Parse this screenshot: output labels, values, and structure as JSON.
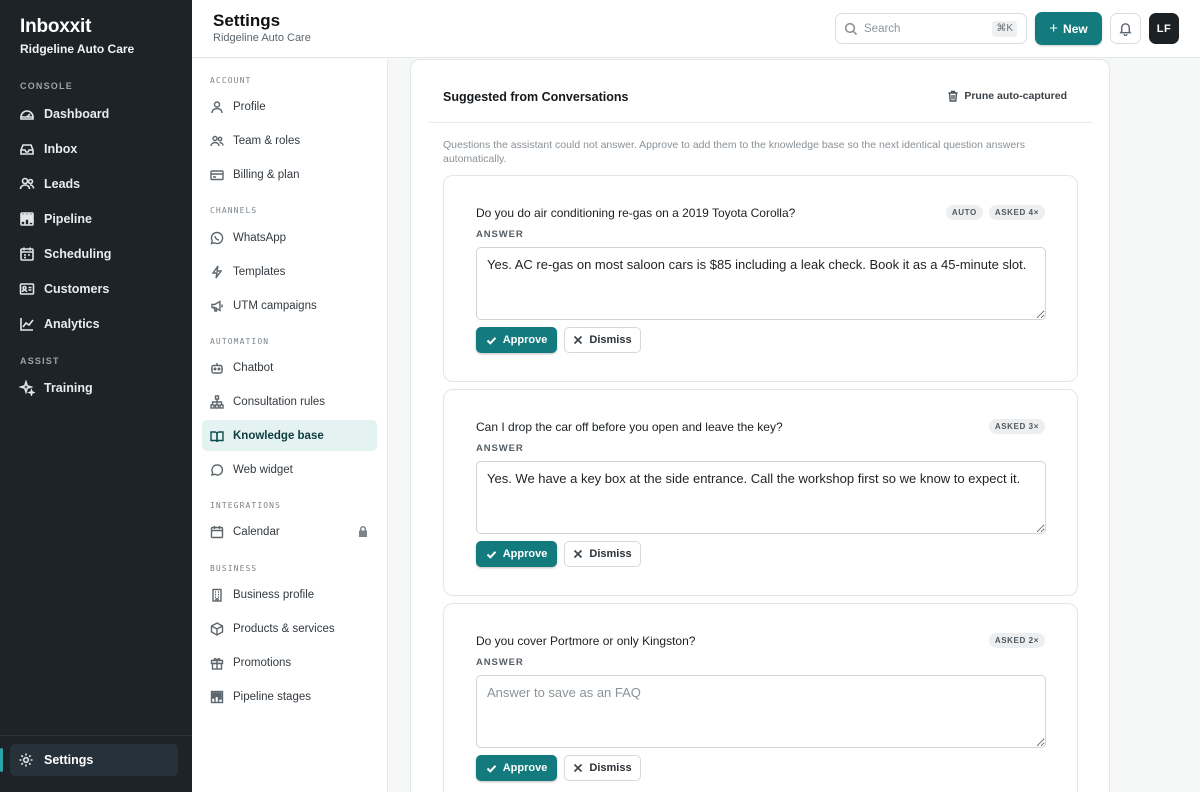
{
  "app": {
    "name": "Inboxxit",
    "workspace": "Ridgeline Auto Care"
  },
  "rail": {
    "console_label": "CONSOLE",
    "assist_label": "ASSIST",
    "items": [
      {
        "label": "Dashboard",
        "icon": "dashboard-icon"
      },
      {
        "label": "Inbox",
        "icon": "inbox-icon"
      },
      {
        "label": "Leads",
        "icon": "users-icon"
      },
      {
        "label": "Pipeline",
        "icon": "pipeline-icon"
      },
      {
        "label": "Scheduling",
        "icon": "calendar-icon"
      },
      {
        "label": "Customers",
        "icon": "id-card-icon"
      },
      {
        "label": "Analytics",
        "icon": "chart-line-icon"
      }
    ],
    "assist_items": [
      {
        "label": "Training",
        "icon": "sparkle-icon"
      }
    ],
    "settings_label": "Settings"
  },
  "header": {
    "title": "Settings",
    "subtitle": "Ridgeline Auto Care",
    "search_placeholder": "Search",
    "search_shortcut": "⌘K",
    "new_label": "New",
    "avatar_initials": "LF"
  },
  "subnav": {
    "sections": {
      "account": "ACCOUNT",
      "channels": "CHANNELS",
      "automation": "AUTOMATION",
      "integrations": "INTEGRATIONS",
      "business": "BUSINESS"
    },
    "account": [
      "Profile",
      "Team & roles",
      "Billing & plan"
    ],
    "channels": [
      "WhatsApp",
      "Templates",
      "UTM campaigns"
    ],
    "automation": [
      "Chatbot",
      "Consultation rules",
      "Knowledge base",
      "Web widget"
    ],
    "integrations": [
      "Calendar"
    ],
    "business": [
      "Business profile",
      "Products & services",
      "Promotions",
      "Pipeline stages"
    ],
    "active": "Knowledge base"
  },
  "panel": {
    "title": "Suggested from Conversations",
    "prune_label": "Prune auto-captured",
    "description": "Questions the assistant could not answer. Approve to add them to the knowledge base so the next identical question answers automatically.",
    "answer_label": "ANSWER",
    "answer_placeholder": "Answer to save as an FAQ",
    "approve_label": "Approve",
    "dismiss_label": "Dismiss",
    "suggestions": [
      {
        "question": "Do you do air conditioning re-gas on a 2019 Toyota Corolla?",
        "auto_badge": "AUTO",
        "asked": "ASKED 4×",
        "answer": "Yes. AC re-gas on most saloon cars is $85 including a leak check. Book it as a 45-minute slot."
      },
      {
        "question": "Can I drop the car off before you open and leave the key?",
        "asked": "ASKED 3×",
        "answer": "Yes. We have a key box at the side entrance. Call the workshop first so we know to expect it."
      },
      {
        "question": "Do you cover Portmore or only Kingston?",
        "asked": "ASKED 2×",
        "answer": ""
      }
    ]
  },
  "colors": {
    "accent": "#137b7e",
    "rail_bg": "#1d2327",
    "active_nav_bg": "#e5f2f2"
  }
}
